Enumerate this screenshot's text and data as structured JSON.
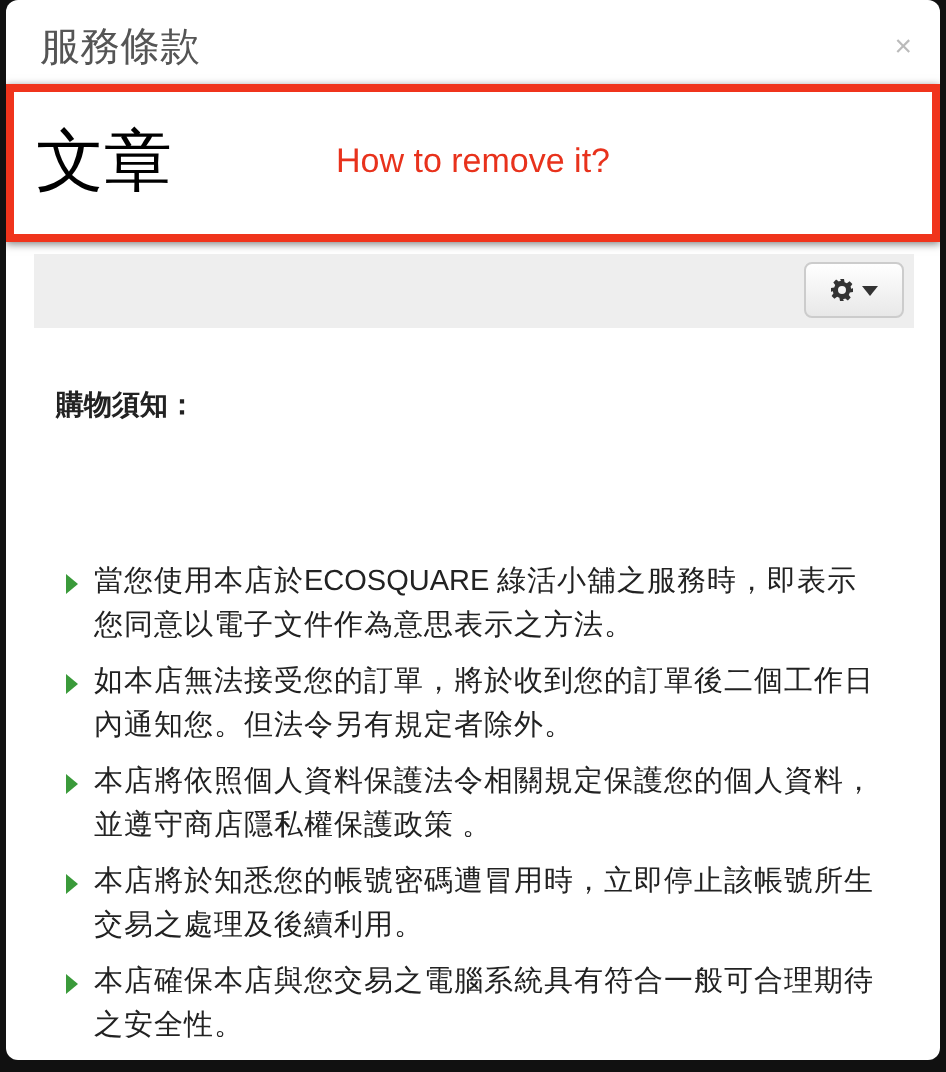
{
  "dialog": {
    "title": "服務條款",
    "close": "×"
  },
  "annotation": {
    "heading": "文章",
    "note": "How to remove it?"
  },
  "toolbar": {
    "settings_button": {
      "expanded": false
    }
  },
  "content": {
    "heading": "購物須知：",
    "items": [
      "當您使用本店於ECOSQUARE 綠活小舖之服務時，即表示您同意以電子文件作為意思表示之方法。",
      "如本店無法接受您的訂單，將於收到您的訂單後二個工作日內通知您。但法令另有規定者除外。",
      "本店將依照個人資料保護法令相關規定保護您的個人資料，並遵守商店隱私權保護政策 。",
      "本店將於知悉您的帳號密碼遭冒用時，立即停止該帳號所生交易之處理及後續利用。",
      "本店確保本店與您交易之電腦系統具有符合一般可合理期待之安全性。"
    ]
  }
}
